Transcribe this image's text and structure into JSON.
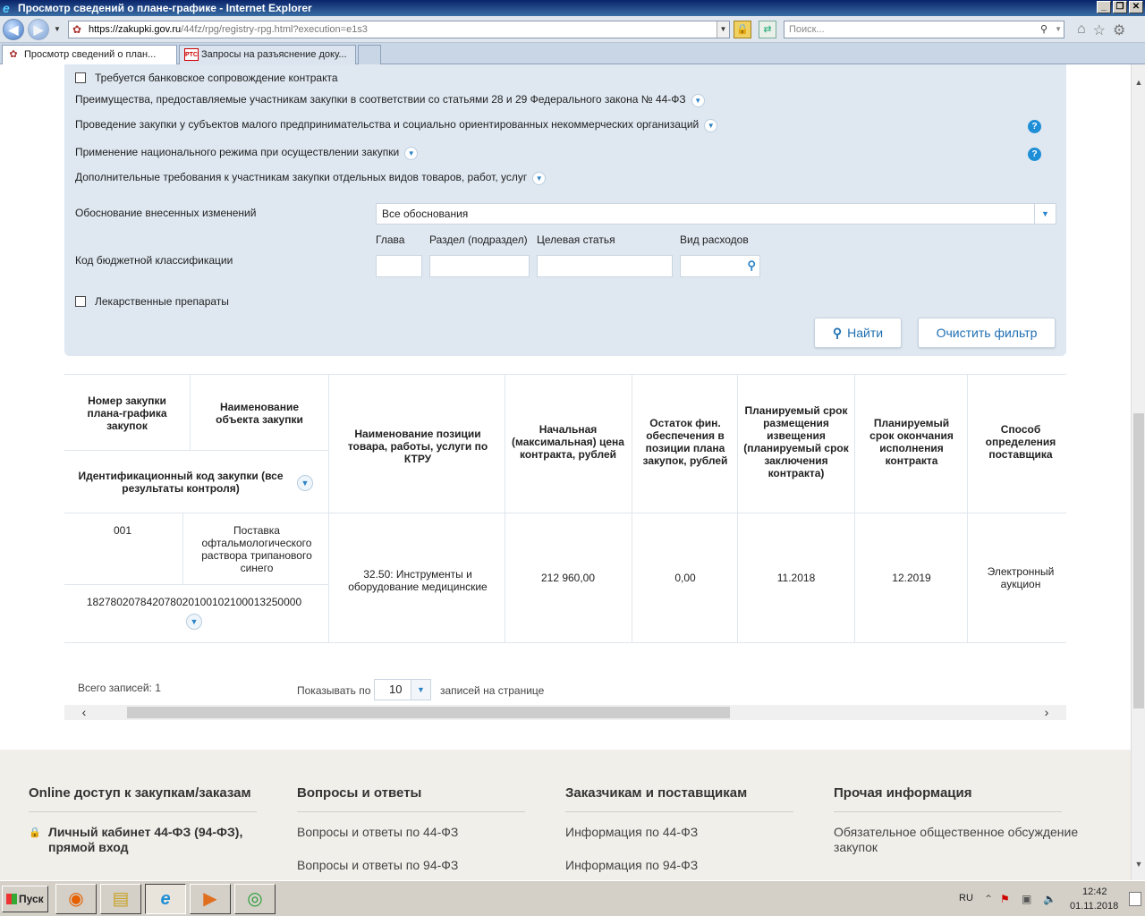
{
  "window": {
    "title": "Просмотр сведений о плане-графике - Internet Explorer",
    "minimize": "_",
    "restore": "❐",
    "close": "✕"
  },
  "address": {
    "url_host": "https://zakupki.gov.ru",
    "url_path": "/44fz/rpg/registry-rpg.html?execution=e1s3",
    "search_placeholder": "Поиск..."
  },
  "tabs": [
    {
      "label": "Просмотр сведений о план...",
      "icon": "coat-of-arms-icon"
    },
    {
      "label": "Запросы на разъяснение доку...",
      "icon": "rts-icon",
      "icon_text": "РТС"
    }
  ],
  "filters": {
    "bank_support": "Требуется банковское сопровождение контракта",
    "advantages": "Преимущества, предоставляемые участникам закупки в соответствии со статьями 28 и 29 Федерального закона № 44-ФЗ",
    "smp": "Проведение закупки у субъектов малого предпринимательства и социально ориентированных некоммерческих организаций",
    "national": "Применение национального режима при осуществлении закупки",
    "additional": "Дополнительные требования к участникам закупки отдельных видов товаров, работ, услуг",
    "changes_label": "Обоснование внесенных изменений",
    "changes_value": "Все обоснования",
    "kbk_label": "Код бюджетной классификации",
    "kbk_chapter": "Глава",
    "kbk_section": "Раздел (подраздел)",
    "kbk_target": "Целевая статья",
    "kbk_expense": "Вид расходов",
    "medicines": "Лекарственные препараты",
    "find_button": "Найти",
    "clear_button": "Очистить фильтр"
  },
  "table": {
    "headers": {
      "number": "Номер закупки плана-графика закупок",
      "object": "Наименование объекта закупки",
      "ikz": "Идентификационный код закупки (все результаты контроля)",
      "position": "Наименование позиции товара, работы, услуги по КТРУ",
      "price": "Начальная (максимальная) цена контракта, рублей",
      "remain": "Остаток фин. обеспечения в позиции плана закупок, рублей",
      "placement": "Планируемый срок размещения извещения (планируемый срок заключения контракта)",
      "end": "Планируемый срок окончания исполнения контракта",
      "method": "Способ определения поставщика"
    },
    "rows": [
      {
        "number": "001",
        "object": "Поставка офтальмологического раствора трипанового синего",
        "ikz": "182780207842078020100102100013250000",
        "position": "32.50: Инструменты и оборудование медицинские",
        "price": "212 960,00",
        "remain": "0,00",
        "placement": "11.2018",
        "end": "12.2019",
        "method": "Электронный аукцион"
      }
    ]
  },
  "pagination": {
    "total": "Всего записей: 1",
    "show_label": "Показывать по",
    "per_page": "10",
    "per_label": "записей на странице"
  },
  "footer": {
    "col1_title": "Online доступ к закупкам/заказам",
    "col1_link1": "Личный кабинет 44-ФЗ (94-ФЗ), прямой вход",
    "col2_title": "Вопросы и ответы",
    "col2_link1": "Вопросы и ответы по 44-ФЗ",
    "col2_link2": "Вопросы и ответы по 94-ФЗ",
    "col3_title": "Заказчикам и поставщикам",
    "col3_link1": "Информация по 44-ФЗ",
    "col3_link2": "Информация по 94-ФЗ",
    "col4_title": "Прочая информация",
    "col4_link1": "Обязательное общественное обсуждение закупок"
  },
  "taskbar": {
    "start": "Пуск",
    "apps": [
      "firefox-icon",
      "explorer-icon",
      "internet-explorer-icon",
      "media-player-icon",
      "chrome-icon"
    ],
    "lang": "RU",
    "time": "12:42",
    "date": "01.11.2018"
  },
  "colors": {
    "filter_bg": "#dfe8f1",
    "accent": "#1f6fb2",
    "footer_bg": "#f1efea"
  }
}
